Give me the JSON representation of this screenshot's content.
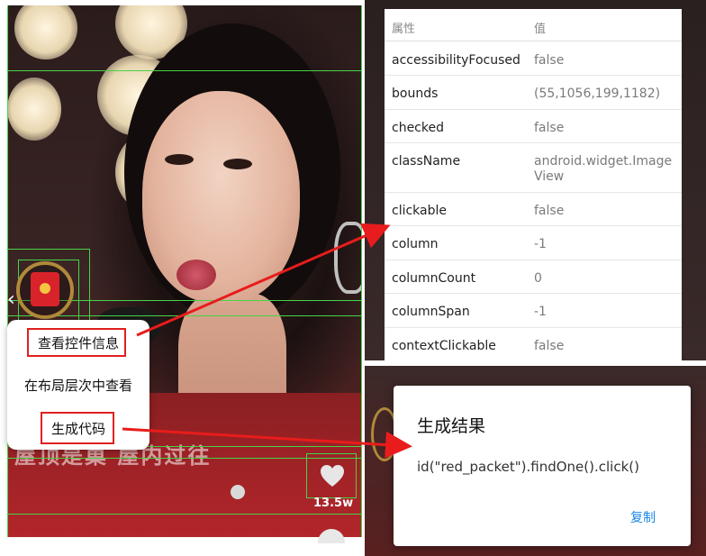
{
  "left_screen": {
    "menu": {
      "items": [
        {
          "label": "查看控件信息"
        },
        {
          "label": "在布局层次中查看"
        },
        {
          "label": "生成代码"
        }
      ]
    },
    "live_title": "屋顶是巢 屋内过往",
    "like_count": "13.5w"
  },
  "attributes_panel": {
    "header": {
      "name_col": "属性",
      "value_col": "值"
    },
    "rows": [
      {
        "name": "accessibilityFocused",
        "value": "false"
      },
      {
        "name": "bounds",
        "value": "(55,1056,199,1182)"
      },
      {
        "name": "checked",
        "value": "false"
      },
      {
        "name": "className",
        "value": "android.widget.ImageView"
      },
      {
        "name": "clickable",
        "value": "false"
      },
      {
        "name": "column",
        "value": "-1"
      },
      {
        "name": "columnCount",
        "value": "0"
      },
      {
        "name": "columnSpan",
        "value": "-1"
      },
      {
        "name": "contextClickable",
        "value": "false"
      }
    ]
  },
  "result_dialog": {
    "title": "生成结果",
    "code": "id(\"red_packet\").findOne().click()",
    "copy_button": "复制"
  },
  "colors": {
    "highlight_red": "#e02020",
    "bounds_green": "#47d447",
    "accent_blue": "#1e88e5"
  }
}
